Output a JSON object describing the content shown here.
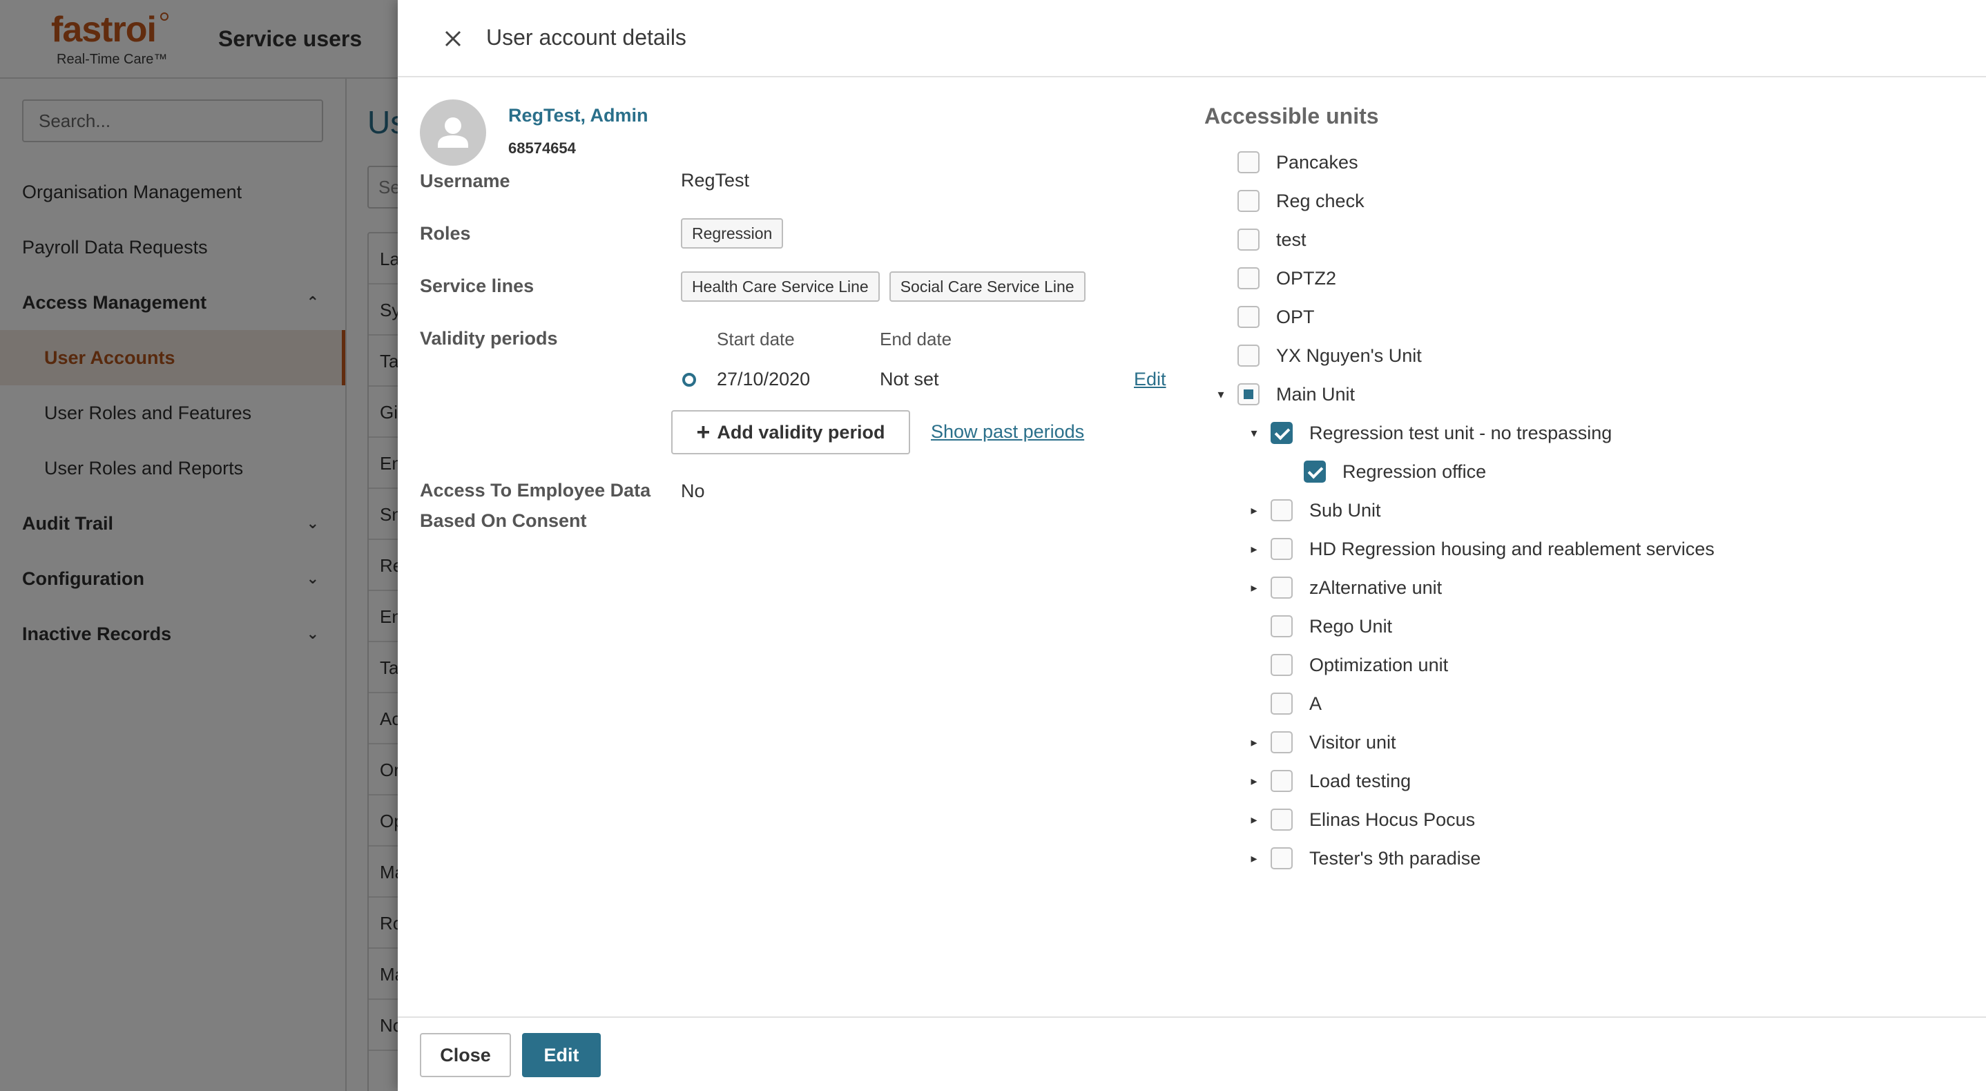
{
  "app": {
    "logo_text": "fastroi",
    "logo_tagline": "Real-Time Care™",
    "title": "Service users"
  },
  "sidebar": {
    "search_placeholder": "Search...",
    "items": [
      {
        "label": "Organisation Management"
      },
      {
        "label": "Payroll Data Requests"
      },
      {
        "label": "Access Management"
      },
      {
        "label": "User Accounts"
      },
      {
        "label": "User Roles and Features"
      },
      {
        "label": "User Roles and Reports"
      },
      {
        "label": "Audit Trail"
      },
      {
        "label": "Configuration"
      },
      {
        "label": "Inactive Records"
      }
    ]
  },
  "background": {
    "page_title_partial": "Us",
    "filter_partial": "Se",
    "table_rows": [
      "La",
      "Sy",
      "Ta",
      "Gi",
      "En",
      "Sn",
      "Re",
      "En",
      "Ta",
      "Ac",
      "Or",
      "Op",
      "Ma",
      "Ro",
      "Ma",
      "No"
    ]
  },
  "drawer": {
    "title": "User account details",
    "user": {
      "name": "RegTest, Admin",
      "id": "68574654"
    },
    "fields": {
      "username_label": "Username",
      "username_value": "RegTest",
      "roles_label": "Roles",
      "roles": [
        "Regression"
      ],
      "service_lines_label": "Service lines",
      "service_lines": [
        "Health Care Service Line",
        "Social Care Service Line"
      ],
      "validity_label": "Validity periods",
      "start_date_header": "Start date",
      "end_date_header": "End date",
      "validity": {
        "start": "27/10/2020",
        "end": "Not set",
        "edit_label": "Edit"
      },
      "add_validity_label": "Add validity period",
      "show_past_label": "Show past periods",
      "consent_label_line1": "Access To Employee Data",
      "consent_label_line2": "Based On Consent",
      "consent_value": "No"
    },
    "units_title": "Accessible units",
    "units": [
      {
        "label": "Pancakes",
        "level": 0,
        "expander": "",
        "state": "unchecked"
      },
      {
        "label": "Reg check",
        "level": 0,
        "expander": "",
        "state": "unchecked"
      },
      {
        "label": "test",
        "level": 0,
        "expander": "",
        "state": "unchecked"
      },
      {
        "label": "OPTZ2",
        "level": 0,
        "expander": "",
        "state": "unchecked"
      },
      {
        "label": "OPT",
        "level": 0,
        "expander": "",
        "state": "unchecked"
      },
      {
        "label": "YX Nguyen's Unit",
        "level": 0,
        "expander": "",
        "state": "unchecked"
      },
      {
        "label": "Main Unit",
        "level": 0,
        "expander": "expanded",
        "state": "partial"
      },
      {
        "label": "Regression test unit - no trespassing",
        "level": 1,
        "expander": "expanded",
        "state": "checked"
      },
      {
        "label": "Regression office",
        "level": 2,
        "expander": "",
        "state": "checked"
      },
      {
        "label": "Sub Unit",
        "level": 1,
        "expander": "collapsed",
        "state": "unchecked"
      },
      {
        "label": "HD Regression housing and reablement services",
        "level": 1,
        "expander": "collapsed",
        "state": "unchecked"
      },
      {
        "label": "zAlternative unit",
        "level": 1,
        "expander": "collapsed",
        "state": "unchecked"
      },
      {
        "label": "Rego Unit",
        "level": 1,
        "expander": "",
        "state": "unchecked"
      },
      {
        "label": "Optimization unit",
        "level": 1,
        "expander": "",
        "state": "unchecked"
      },
      {
        "label": "A",
        "level": 1,
        "expander": "",
        "state": "unchecked"
      },
      {
        "label": "Visitor unit",
        "level": 1,
        "expander": "collapsed",
        "state": "unchecked"
      },
      {
        "label": "Load testing",
        "level": 1,
        "expander": "collapsed",
        "state": "unchecked"
      },
      {
        "label": "Elinas Hocus Pocus",
        "level": 1,
        "expander": "collapsed",
        "state": "unchecked"
      },
      {
        "label": "Tester's 9th paradise",
        "level": 1,
        "expander": "collapsed",
        "state": "unchecked"
      }
    ],
    "footer": {
      "close_label": "Close",
      "edit_label": "Edit"
    }
  },
  "colors": {
    "accent": "#2a6f8a",
    "brand": "#c4581c"
  }
}
